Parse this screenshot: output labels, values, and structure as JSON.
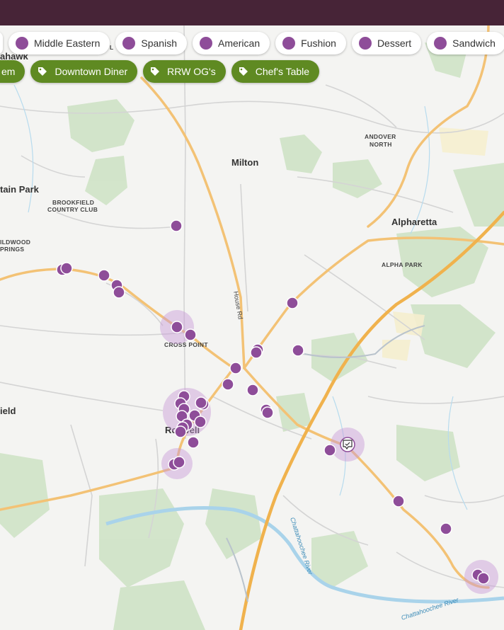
{
  "header": {
    "color": "#472437"
  },
  "category_filters": [
    {
      "label": ""
    },
    {
      "label": "Middle Eastern"
    },
    {
      "label": "Spanish"
    },
    {
      "label": "American"
    },
    {
      "label": "Fushion"
    },
    {
      "label": "Dessert"
    },
    {
      "label": "Sandwich"
    }
  ],
  "tag_filters": [
    {
      "label": "em"
    },
    {
      "label": "Downtown Diner"
    },
    {
      "label": "RRW OG's"
    },
    {
      "label": "Chef's Table"
    }
  ],
  "map": {
    "place_labels": {
      "mohawk": "ahawk",
      "milton": "Milton",
      "andover": "ANDOVER",
      "andover2": "NORTH",
      "mountain_park": "tain Park",
      "brookfield1": "BROOKFIELD",
      "brookfield2": "COUNTRY CLUB",
      "alpharetta": "Alpharetta",
      "wildwood1": "ILDWOOD",
      "wildwood2": "PRINGS",
      "alpha_park": "ALPHA PARK",
      "cross_point": "CROSS POINT",
      "field": "ield",
      "roswell": "Roswell",
      "road_house": "House Rd",
      "river1": "Chattahoochee River",
      "river2": "Chattahoochee River",
      "top_fragment": "L"
    },
    "colors": {
      "marker": "#8e4d99",
      "highlight_glow": "#c89ad6",
      "highway": "#f3c275",
      "park": "#cfe3c6",
      "water": "#a9d3ea"
    }
  }
}
